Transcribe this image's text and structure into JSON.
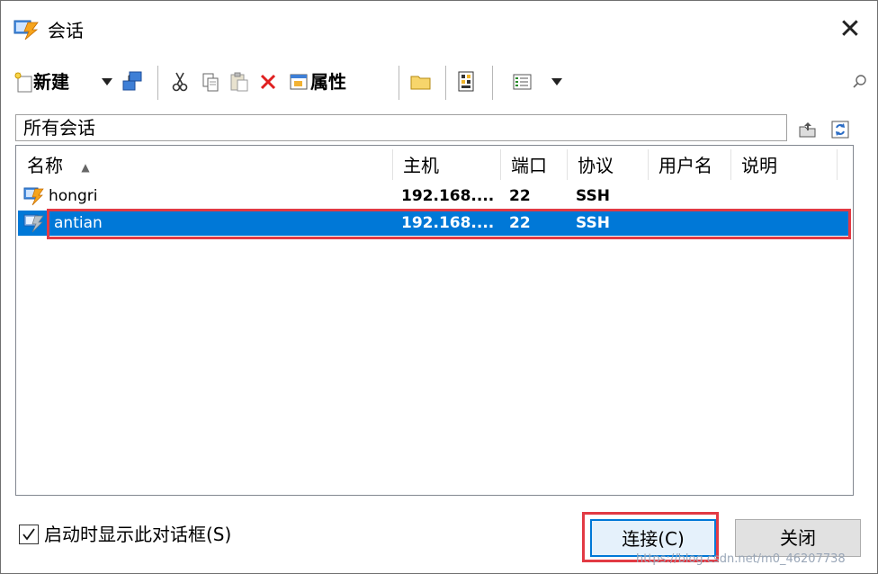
{
  "window": {
    "title": "会话",
    "close_glyph": "✕"
  },
  "toolbar": {
    "new_label": "新建",
    "properties_label": "属性",
    "search": {
      "placeholder": "",
      "value": ""
    },
    "icons": [
      "new-session-icon",
      "dropdown-caret-icon",
      "copy-session-icon",
      "cut-icon",
      "copy-icon",
      "paste-icon",
      "delete-icon",
      "properties-icon",
      "folder-icon",
      "import-export-icon",
      "view-icon",
      "dropdown-caret-icon",
      "search-icon"
    ]
  },
  "pathbar": {
    "label": "所有会话"
  },
  "list": {
    "columns": [
      "名称",
      "主机",
      "端口",
      "协议",
      "用户名",
      "说明"
    ],
    "sort_indicator": "▲",
    "rows": [
      {
        "name": "hongri",
        "host": "192.168....",
        "port": "22",
        "protocol": "SSH",
        "user": "",
        "note": ""
      },
      {
        "name": "antian",
        "host": "192.168....",
        "port": "22",
        "protocol": "SSH",
        "user": "",
        "note": "",
        "selected": true
      }
    ]
  },
  "footer": {
    "checkbox_label": "启动时显示此对话框(S)",
    "checkbox_checked": true,
    "connect_label": "连接(C)",
    "close_label": "关闭"
  },
  "watermark": "https://blog.csdn.net/m0_46207738",
  "colors": {
    "selection": "#0078d7",
    "annotation_red": "#e23a44"
  }
}
